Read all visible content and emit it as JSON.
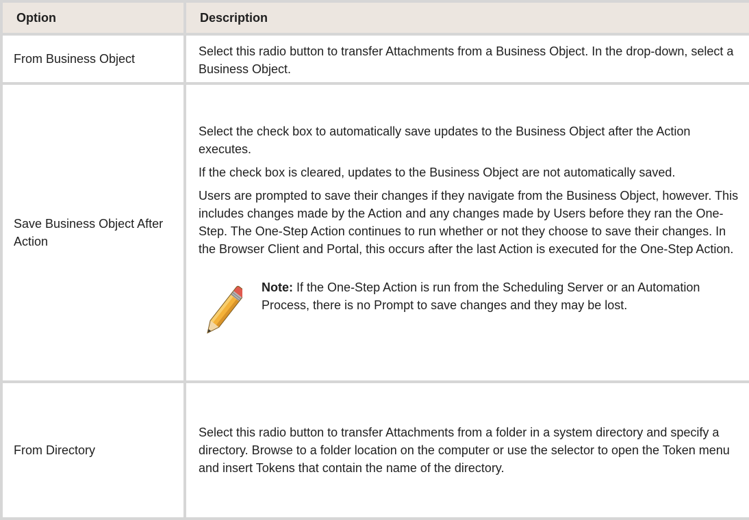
{
  "table": {
    "headers": {
      "option": "Option",
      "description": "Description"
    },
    "rows": [
      {
        "option": "From Business Object",
        "paragraphs": [
          "Select this radio button to transfer Attachments from a Business Object. In the drop-down, select a Business Object."
        ]
      },
      {
        "option": "Save Business Object After Action",
        "paragraphs": [
          "Select the check box to automatically save updates to the Business Object after the Action executes.",
          "If the check box is cleared, updates to the Business Object are not automatically saved.",
          "Users are prompted to save their changes if they navigate from the Business Object, however. This includes changes made by the Action and any changes made by Users before they ran the One-Step. The One-Step Action continues to run whether or not they choose to save their changes. In the Browser Client and Portal, this occurs after the last Action is executed for the One-Step Action."
        ],
        "note": {
          "label": "Note:",
          "text": "If the One-Step Action is run from the Scheduling Server or an Automation Process, there is no Prompt to save changes and they may be lost.",
          "icon": "pencil-icon"
        }
      },
      {
        "option": "From Directory",
        "paragraphs": [
          "Select this radio button to transfer Attachments from a folder in a system directory and specify a directory. Browse to a folder location on the computer or use the selector to open the Token menu and insert Tokens that contain the name of the directory."
        ]
      }
    ]
  },
  "colors": {
    "header_bg": "#ece6e0",
    "border": "#d6d6d6",
    "text": "#1f1f1f"
  }
}
